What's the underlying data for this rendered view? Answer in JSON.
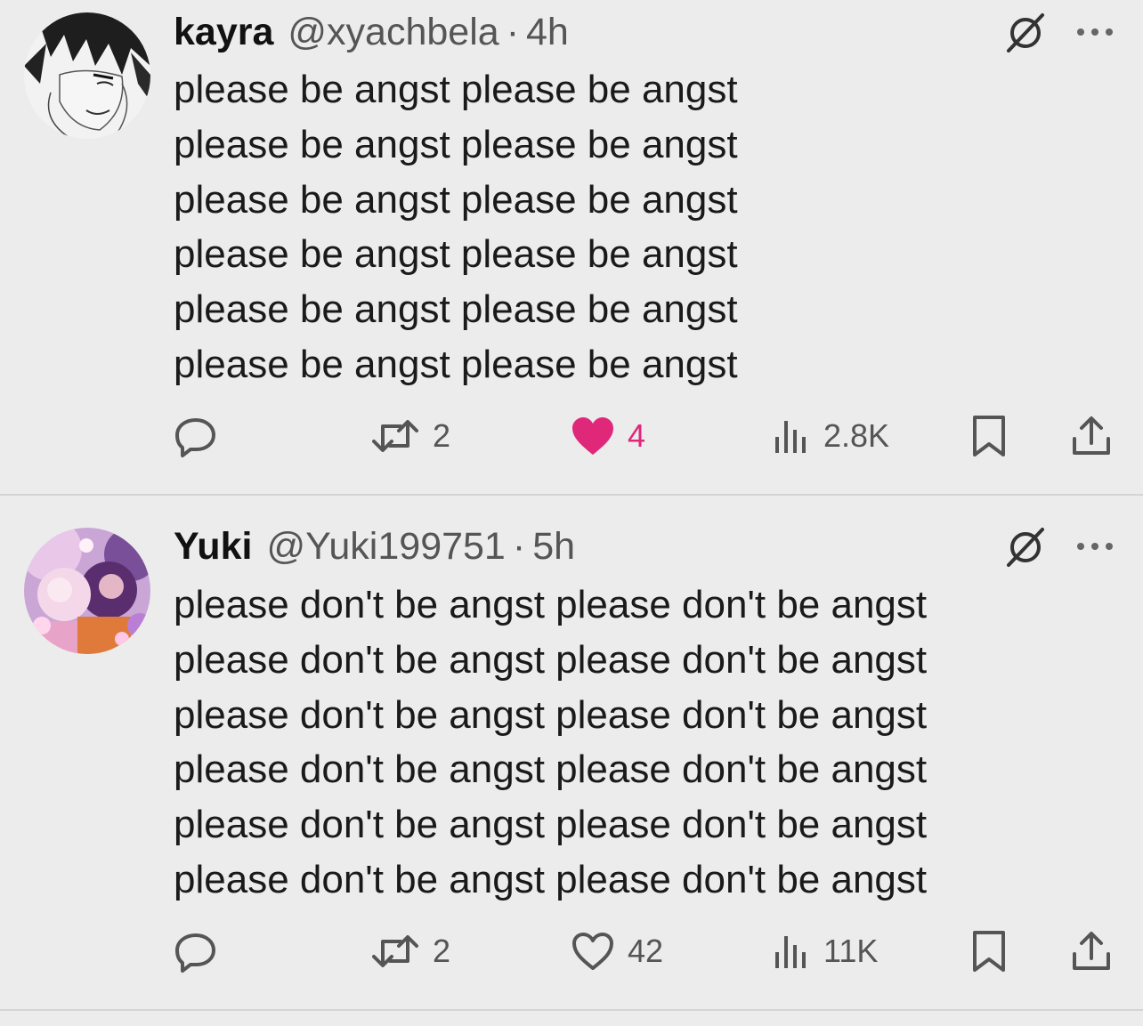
{
  "tweets": [
    {
      "display_name": "kayra",
      "handle": "@xyachbela",
      "separator": "·",
      "time": "4h",
      "lines": [
        "please be angst please be angst",
        "please be angst please be angst",
        "please be angst please be angst",
        "please be angst please be angst",
        "please be angst please be angst",
        "please be angst please be angst"
      ],
      "retweets": "2",
      "likes": "4",
      "liked": true,
      "views": "2.8K"
    },
    {
      "display_name": "Yuki",
      "handle": "@Yuki199751",
      "separator": "·",
      "time": "5h",
      "lines": [
        "please don't be angst please don't be angst",
        "please don't be angst please don't be angst",
        "please don't be angst please don't be angst",
        "please don't be angst please don't be angst",
        "please don't be angst please don't be angst",
        "please don't be angst please don't be angst"
      ],
      "retweets": "2",
      "likes": "42",
      "liked": false,
      "views": "11K"
    }
  ],
  "icons": {
    "reply": "reply-icon",
    "retweet": "retweet-icon",
    "like": "heart-icon",
    "views": "views-icon",
    "bookmark": "bookmark-icon",
    "share": "share-icon",
    "grok": "grok-icon",
    "more": "more-icon"
  },
  "colors": {
    "background": "#ececec",
    "like_active": "#e0287a",
    "text": "#1a1a1a",
    "secondary": "#555555"
  }
}
